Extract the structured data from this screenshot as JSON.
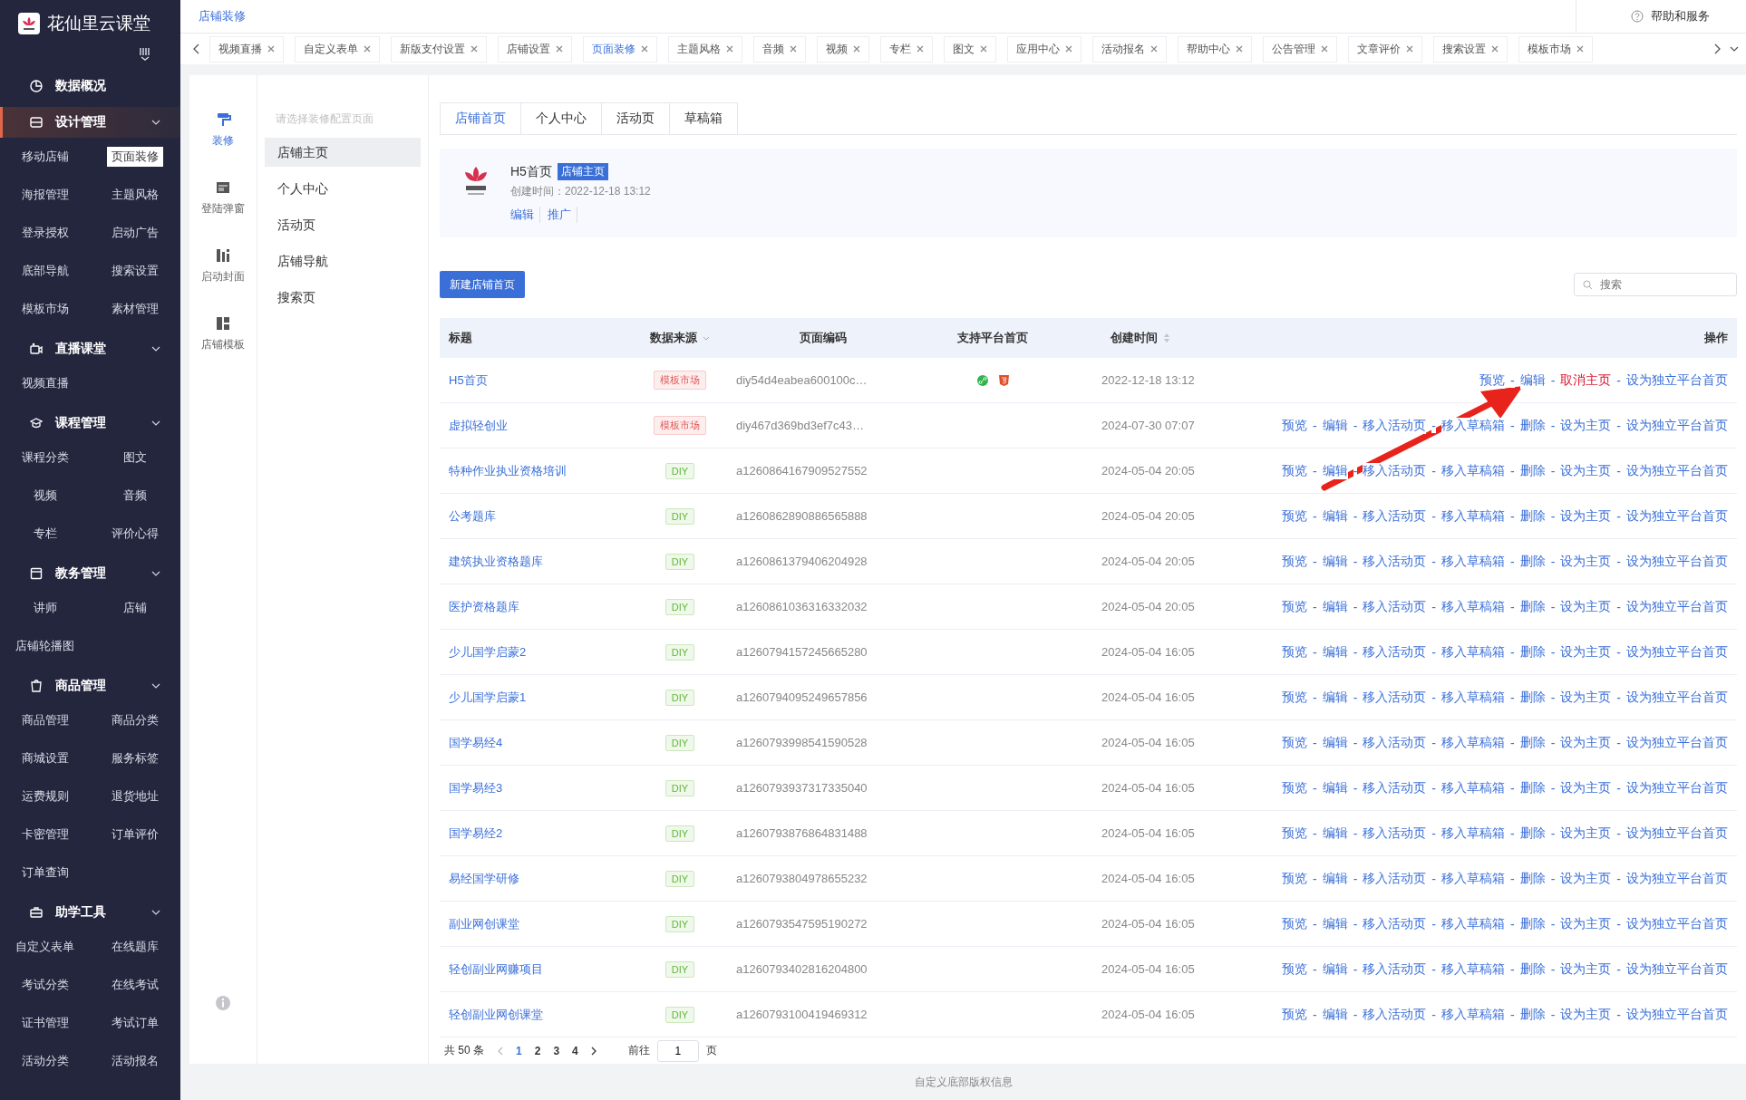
{
  "brand": {
    "name": "花仙里云课堂"
  },
  "sidebar": {
    "sections": [
      {
        "title": "数据概况",
        "kind": "link",
        "active": false
      },
      {
        "title": "设计管理",
        "kind": "group",
        "active": true,
        "items": [
          {
            "label": "移动店铺",
            "selected": false
          },
          {
            "label": "页面装修",
            "selected": true
          },
          {
            "label": "海报管理",
            "selected": false
          },
          {
            "label": "主题风格",
            "selected": false
          },
          {
            "label": "登录授权",
            "selected": false
          },
          {
            "label": "启动广告",
            "selected": false
          },
          {
            "label": "底部导航",
            "selected": false
          },
          {
            "label": "搜索设置",
            "selected": false
          },
          {
            "label": "模板市场",
            "selected": false
          },
          {
            "label": "素材管理",
            "selected": false
          }
        ]
      },
      {
        "title": "直播课堂",
        "kind": "group",
        "active": false,
        "items": [
          {
            "label": "视频直播",
            "selected": false
          }
        ]
      },
      {
        "title": "课程管理",
        "kind": "group",
        "active": false,
        "items": [
          {
            "label": "课程分类",
            "selected": false
          },
          {
            "label": "图文",
            "selected": false
          },
          {
            "label": "视频",
            "selected": false
          },
          {
            "label": "音频",
            "selected": false
          },
          {
            "label": "专栏",
            "selected": false
          },
          {
            "label": "评价心得",
            "selected": false
          }
        ]
      },
      {
        "title": "教务管理",
        "kind": "group",
        "active": false,
        "items": [
          {
            "label": "讲师",
            "selected": false
          },
          {
            "label": "店铺",
            "selected": false
          },
          {
            "label": "店铺轮播图",
            "selected": false
          }
        ]
      },
      {
        "title": "商品管理",
        "kind": "group",
        "active": false,
        "items": [
          {
            "label": "商品管理",
            "selected": false
          },
          {
            "label": "商品分类",
            "selected": false
          },
          {
            "label": "商城设置",
            "selected": false
          },
          {
            "label": "服务标签",
            "selected": false
          },
          {
            "label": "运费规则",
            "selected": false
          },
          {
            "label": "退货地址",
            "selected": false
          },
          {
            "label": "卡密管理",
            "selected": false
          },
          {
            "label": "订单评价",
            "selected": false
          },
          {
            "label": "订单查询",
            "selected": false
          }
        ]
      },
      {
        "title": "助学工具",
        "kind": "group",
        "active": false,
        "items": [
          {
            "label": "自定义表单",
            "selected": false
          },
          {
            "label": "在线题库",
            "selected": false
          },
          {
            "label": "考试分类",
            "selected": false
          },
          {
            "label": "在线考试",
            "selected": false
          },
          {
            "label": "证书管理",
            "selected": false
          },
          {
            "label": "考试订单",
            "selected": false
          },
          {
            "label": "活动分类",
            "selected": false
          },
          {
            "label": "活动报名",
            "selected": false
          }
        ]
      }
    ]
  },
  "breadcrumb": "店铺装修",
  "help": "帮助和服务",
  "tabs": [
    {
      "label": "视频直播",
      "selected": false
    },
    {
      "label": "自定义表单",
      "selected": false
    },
    {
      "label": "新版支付设置",
      "selected": false
    },
    {
      "label": "店铺设置",
      "selected": false
    },
    {
      "label": "页面装修",
      "selected": true
    },
    {
      "label": "主题风格",
      "selected": false
    },
    {
      "label": "音频",
      "selected": false
    },
    {
      "label": "视频",
      "selected": false
    },
    {
      "label": "专栏",
      "selected": false
    },
    {
      "label": "图文",
      "selected": false
    },
    {
      "label": "应用中心",
      "selected": false
    },
    {
      "label": "活动报名",
      "selected": false
    },
    {
      "label": "帮助中心",
      "selected": false
    },
    {
      "label": "公告管理",
      "selected": false
    },
    {
      "label": "文章评价",
      "selected": false
    },
    {
      "label": "搜索设置",
      "selected": false
    },
    {
      "label": "模板市场",
      "selected": false
    }
  ],
  "tool_rail": [
    {
      "label": "装修",
      "selected": true
    },
    {
      "label": "登陆弹窗",
      "selected": false
    },
    {
      "label": "启动封面",
      "selected": false
    },
    {
      "label": "店铺模板",
      "selected": false
    }
  ],
  "page_menu": {
    "placeholder": "请选择装修配置页面",
    "items": [
      {
        "label": "店铺主页",
        "selected": true
      },
      {
        "label": "个人中心",
        "selected": false
      },
      {
        "label": "活动页",
        "selected": false
      },
      {
        "label": "店铺导航",
        "selected": false
      },
      {
        "label": "搜索页",
        "selected": false
      }
    ]
  },
  "page_tabs": [
    {
      "label": "店铺首页",
      "selected": true
    },
    {
      "label": "个人中心",
      "selected": false
    },
    {
      "label": "活动页",
      "selected": false
    },
    {
      "label": "草稿箱",
      "selected": false
    }
  ],
  "home_card": {
    "title": "H5首页",
    "badge": "店铺主页",
    "created": "创建时间：2022-12-18 13:12",
    "links": [
      "编辑",
      "推广"
    ]
  },
  "new_button": "新建店铺首页",
  "search": {
    "placeholder": "搜索"
  },
  "table": {
    "columns": [
      {
        "label": "标题",
        "kind": "plain"
      },
      {
        "label": "数据来源",
        "kind": "filter"
      },
      {
        "label": "页面编码",
        "kind": "plain"
      },
      {
        "label": "支持平台首页",
        "kind": "plain"
      },
      {
        "label": "创建时间",
        "kind": "sort"
      },
      {
        "label": "操作",
        "kind": "plain"
      }
    ],
    "rows": [
      {
        "title": "H5首页",
        "source": {
          "label": "模板市场",
          "kind": "market"
        },
        "code": "diy54d4eabea600100c…",
        "platform_home": true,
        "created": "2022-12-18 13:12",
        "actions": [
          {
            "label": "预览",
            "kind": "link"
          },
          {
            "label": "-",
            "kind": "sep"
          },
          {
            "label": "编辑",
            "kind": "link"
          },
          {
            "label": "-",
            "kind": "sep"
          },
          {
            "label": "取消主页",
            "kind": "danger"
          },
          {
            "label": "-",
            "kind": "sep"
          },
          {
            "label": "设为独立平台首页",
            "kind": "link"
          }
        ]
      },
      {
        "title": "虚拟轻创业",
        "source": {
          "label": "模板市场",
          "kind": "market"
        },
        "code": "diy467d369bd3ef7c43…",
        "created": "2024-07-30 07:07",
        "actions": [
          {
            "label": "预览",
            "kind": "link"
          },
          {
            "label": "-",
            "kind": "sep"
          },
          {
            "label": "编辑",
            "kind": "link"
          },
          {
            "label": "-",
            "kind": "sep"
          },
          {
            "label": "移入活动页",
            "kind": "link"
          },
          {
            "label": "-",
            "kind": "sep"
          },
          {
            "label": "移入草稿箱",
            "kind": "link"
          },
          {
            "label": "-",
            "kind": "sep"
          },
          {
            "label": "删除",
            "kind": "link"
          },
          {
            "label": "-",
            "kind": "sep"
          },
          {
            "label": "设为主页",
            "kind": "link"
          },
          {
            "label": "-",
            "kind": "sep"
          },
          {
            "label": "设为独立平台首页",
            "kind": "link"
          }
        ]
      },
      {
        "title": "特种作业执业资格培训",
        "source": {
          "label": "DIY",
          "kind": "diy"
        },
        "code": "a1260864167909527552",
        "created": "2024-05-04 20:05",
        "actions": [
          {
            "label": "预览",
            "kind": "link"
          },
          {
            "label": "-",
            "kind": "sep"
          },
          {
            "label": "编辑",
            "kind": "link"
          },
          {
            "label": "-",
            "kind": "sep"
          },
          {
            "label": "移入活动页",
            "kind": "link"
          },
          {
            "label": "-",
            "kind": "sep"
          },
          {
            "label": "移入草稿箱",
            "kind": "link"
          },
          {
            "label": "-",
            "kind": "sep"
          },
          {
            "label": "删除",
            "kind": "link"
          },
          {
            "label": "-",
            "kind": "sep"
          },
          {
            "label": "设为主页",
            "kind": "link"
          },
          {
            "label": "-",
            "kind": "sep"
          },
          {
            "label": "设为独立平台首页",
            "kind": "link"
          }
        ]
      },
      {
        "title": "公考题库",
        "source": {
          "label": "DIY",
          "kind": "diy"
        },
        "code": "a1260862890886565888",
        "created": "2024-05-04 20:05",
        "actions": [
          {
            "label": "预览",
            "kind": "link"
          },
          {
            "label": "-",
            "kind": "sep"
          },
          {
            "label": "编辑",
            "kind": "link"
          },
          {
            "label": "-",
            "kind": "sep"
          },
          {
            "label": "移入活动页",
            "kind": "link"
          },
          {
            "label": "-",
            "kind": "sep"
          },
          {
            "label": "移入草稿箱",
            "kind": "link"
          },
          {
            "label": "-",
            "kind": "sep"
          },
          {
            "label": "删除",
            "kind": "link"
          },
          {
            "label": "-",
            "kind": "sep"
          },
          {
            "label": "设为主页",
            "kind": "link"
          },
          {
            "label": "-",
            "kind": "sep"
          },
          {
            "label": "设为独立平台首页",
            "kind": "link"
          }
        ]
      },
      {
        "title": "建筑执业资格题库",
        "source": {
          "label": "DIY",
          "kind": "diy"
        },
        "code": "a1260861379406204928",
        "created": "2024-05-04 20:05",
        "actions": [
          {
            "label": "预览",
            "kind": "link"
          },
          {
            "label": "-",
            "kind": "sep"
          },
          {
            "label": "编辑",
            "kind": "link"
          },
          {
            "label": "-",
            "kind": "sep"
          },
          {
            "label": "移入活动页",
            "kind": "link"
          },
          {
            "label": "-",
            "kind": "sep"
          },
          {
            "label": "移入草稿箱",
            "kind": "link"
          },
          {
            "label": "-",
            "kind": "sep"
          },
          {
            "label": "删除",
            "kind": "link"
          },
          {
            "label": "-",
            "kind": "sep"
          },
          {
            "label": "设为主页",
            "kind": "link"
          },
          {
            "label": "-",
            "kind": "sep"
          },
          {
            "label": "设为独立平台首页",
            "kind": "link"
          }
        ]
      },
      {
        "title": "医护资格题库",
        "source": {
          "label": "DIY",
          "kind": "diy"
        },
        "code": "a1260861036316332032",
        "created": "2024-05-04 20:05",
        "actions": [
          {
            "label": "预览",
            "kind": "link"
          },
          {
            "label": "-",
            "kind": "sep"
          },
          {
            "label": "编辑",
            "kind": "link"
          },
          {
            "label": "-",
            "kind": "sep"
          },
          {
            "label": "移入活动页",
            "kind": "link"
          },
          {
            "label": "-",
            "kind": "sep"
          },
          {
            "label": "移入草稿箱",
            "kind": "link"
          },
          {
            "label": "-",
            "kind": "sep"
          },
          {
            "label": "删除",
            "kind": "link"
          },
          {
            "label": "-",
            "kind": "sep"
          },
          {
            "label": "设为主页",
            "kind": "link"
          },
          {
            "label": "-",
            "kind": "sep"
          },
          {
            "label": "设为独立平台首页",
            "kind": "link"
          }
        ]
      },
      {
        "title": "少儿国学启蒙2",
        "source": {
          "label": "DIY",
          "kind": "diy"
        },
        "code": "a1260794157245665280",
        "created": "2024-05-04 16:05",
        "actions": [
          {
            "label": "预览",
            "kind": "link"
          },
          {
            "label": "-",
            "kind": "sep"
          },
          {
            "label": "编辑",
            "kind": "link"
          },
          {
            "label": "-",
            "kind": "sep"
          },
          {
            "label": "移入活动页",
            "kind": "link"
          },
          {
            "label": "-",
            "kind": "sep"
          },
          {
            "label": "移入草稿箱",
            "kind": "link"
          },
          {
            "label": "-",
            "kind": "sep"
          },
          {
            "label": "删除",
            "kind": "link"
          },
          {
            "label": "-",
            "kind": "sep"
          },
          {
            "label": "设为主页",
            "kind": "link"
          },
          {
            "label": "-",
            "kind": "sep"
          },
          {
            "label": "设为独立平台首页",
            "kind": "link"
          }
        ]
      },
      {
        "title": "少儿国学启蒙1",
        "source": {
          "label": "DIY",
          "kind": "diy"
        },
        "code": "a1260794095249657856",
        "created": "2024-05-04 16:05",
        "actions": [
          {
            "label": "预览",
            "kind": "link"
          },
          {
            "label": "-",
            "kind": "sep"
          },
          {
            "label": "编辑",
            "kind": "link"
          },
          {
            "label": "-",
            "kind": "sep"
          },
          {
            "label": "移入活动页",
            "kind": "link"
          },
          {
            "label": "-",
            "kind": "sep"
          },
          {
            "label": "移入草稿箱",
            "kind": "link"
          },
          {
            "label": "-",
            "kind": "sep"
          },
          {
            "label": "删除",
            "kind": "link"
          },
          {
            "label": "-",
            "kind": "sep"
          },
          {
            "label": "设为主页",
            "kind": "link"
          },
          {
            "label": "-",
            "kind": "sep"
          },
          {
            "label": "设为独立平台首页",
            "kind": "link"
          }
        ]
      },
      {
        "title": "国学易经4",
        "source": {
          "label": "DIY",
          "kind": "diy"
        },
        "code": "a1260793998541590528",
        "created": "2024-05-04 16:05",
        "actions": [
          {
            "label": "预览",
            "kind": "link"
          },
          {
            "label": "-",
            "kind": "sep"
          },
          {
            "label": "编辑",
            "kind": "link"
          },
          {
            "label": "-",
            "kind": "sep"
          },
          {
            "label": "移入活动页",
            "kind": "link"
          },
          {
            "label": "-",
            "kind": "sep"
          },
          {
            "label": "移入草稿箱",
            "kind": "link"
          },
          {
            "label": "-",
            "kind": "sep"
          },
          {
            "label": "删除",
            "kind": "link"
          },
          {
            "label": "-",
            "kind": "sep"
          },
          {
            "label": "设为主页",
            "kind": "link"
          },
          {
            "label": "-",
            "kind": "sep"
          },
          {
            "label": "设为独立平台首页",
            "kind": "link"
          }
        ]
      },
      {
        "title": "国学易经3",
        "source": {
          "label": "DIY",
          "kind": "diy"
        },
        "code": "a1260793937317335040",
        "created": "2024-05-04 16:05",
        "actions": [
          {
            "label": "预览",
            "kind": "link"
          },
          {
            "label": "-",
            "kind": "sep"
          },
          {
            "label": "编辑",
            "kind": "link"
          },
          {
            "label": "-",
            "kind": "sep"
          },
          {
            "label": "移入活动页",
            "kind": "link"
          },
          {
            "label": "-",
            "kind": "sep"
          },
          {
            "label": "移入草稿箱",
            "kind": "link"
          },
          {
            "label": "-",
            "kind": "sep"
          },
          {
            "label": "删除",
            "kind": "link"
          },
          {
            "label": "-",
            "kind": "sep"
          },
          {
            "label": "设为主页",
            "kind": "link"
          },
          {
            "label": "-",
            "kind": "sep"
          },
          {
            "label": "设为独立平台首页",
            "kind": "link"
          }
        ]
      },
      {
        "title": "国学易经2",
        "source": {
          "label": "DIY",
          "kind": "diy"
        },
        "code": "a1260793876864831488",
        "created": "2024-05-04 16:05",
        "actions": [
          {
            "label": "预览",
            "kind": "link"
          },
          {
            "label": "-",
            "kind": "sep"
          },
          {
            "label": "编辑",
            "kind": "link"
          },
          {
            "label": "-",
            "kind": "sep"
          },
          {
            "label": "移入活动页",
            "kind": "link"
          },
          {
            "label": "-",
            "kind": "sep"
          },
          {
            "label": "移入草稿箱",
            "kind": "link"
          },
          {
            "label": "-",
            "kind": "sep"
          },
          {
            "label": "删除",
            "kind": "link"
          },
          {
            "label": "-",
            "kind": "sep"
          },
          {
            "label": "设为主页",
            "kind": "link"
          },
          {
            "label": "-",
            "kind": "sep"
          },
          {
            "label": "设为独立平台首页",
            "kind": "link"
          }
        ]
      },
      {
        "title": "易经国学研修",
        "source": {
          "label": "DIY",
          "kind": "diy"
        },
        "code": "a1260793804978655232",
        "created": "2024-05-04 16:05",
        "actions": [
          {
            "label": "预览",
            "kind": "link"
          },
          {
            "label": "-",
            "kind": "sep"
          },
          {
            "label": "编辑",
            "kind": "link"
          },
          {
            "label": "-",
            "kind": "sep"
          },
          {
            "label": "移入活动页",
            "kind": "link"
          },
          {
            "label": "-",
            "kind": "sep"
          },
          {
            "label": "移入草稿箱",
            "kind": "link"
          },
          {
            "label": "-",
            "kind": "sep"
          },
          {
            "label": "删除",
            "kind": "link"
          },
          {
            "label": "-",
            "kind": "sep"
          },
          {
            "label": "设为主页",
            "kind": "link"
          },
          {
            "label": "-",
            "kind": "sep"
          },
          {
            "label": "设为独立平台首页",
            "kind": "link"
          }
        ]
      },
      {
        "title": "副业网创课堂",
        "source": {
          "label": "DIY",
          "kind": "diy"
        },
        "code": "a1260793547595190272",
        "created": "2024-05-04 16:05",
        "actions": [
          {
            "label": "预览",
            "kind": "link"
          },
          {
            "label": "-",
            "kind": "sep"
          },
          {
            "label": "编辑",
            "kind": "link"
          },
          {
            "label": "-",
            "kind": "sep"
          },
          {
            "label": "移入活动页",
            "kind": "link"
          },
          {
            "label": "-",
            "kind": "sep"
          },
          {
            "label": "移入草稿箱",
            "kind": "link"
          },
          {
            "label": "-",
            "kind": "sep"
          },
          {
            "label": "删除",
            "kind": "link"
          },
          {
            "label": "-",
            "kind": "sep"
          },
          {
            "label": "设为主页",
            "kind": "link"
          },
          {
            "label": "-",
            "kind": "sep"
          },
          {
            "label": "设为独立平台首页",
            "kind": "link"
          }
        ]
      },
      {
        "title": "轻创副业网赚项目",
        "source": {
          "label": "DIY",
          "kind": "diy"
        },
        "code": "a1260793402816204800",
        "created": "2024-05-04 16:05",
        "actions": [
          {
            "label": "预览",
            "kind": "link"
          },
          {
            "label": "-",
            "kind": "sep"
          },
          {
            "label": "编辑",
            "kind": "link"
          },
          {
            "label": "-",
            "kind": "sep"
          },
          {
            "label": "移入活动页",
            "kind": "link"
          },
          {
            "label": "-",
            "kind": "sep"
          },
          {
            "label": "移入草稿箱",
            "kind": "link"
          },
          {
            "label": "-",
            "kind": "sep"
          },
          {
            "label": "删除",
            "kind": "link"
          },
          {
            "label": "-",
            "kind": "sep"
          },
          {
            "label": "设为主页",
            "kind": "link"
          },
          {
            "label": "-",
            "kind": "sep"
          },
          {
            "label": "设为独立平台首页",
            "kind": "link"
          }
        ]
      },
      {
        "title": "轻创副业网创课堂",
        "source": {
          "label": "DIY",
          "kind": "diy"
        },
        "code": "a1260793100419469312",
        "created": "2024-05-04 16:05",
        "actions": [
          {
            "label": "预览",
            "kind": "link"
          },
          {
            "label": "-",
            "kind": "sep"
          },
          {
            "label": "编辑",
            "kind": "link"
          },
          {
            "label": "-",
            "kind": "sep"
          },
          {
            "label": "移入活动页",
            "kind": "link"
          },
          {
            "label": "-",
            "kind": "sep"
          },
          {
            "label": "移入草稿箱",
            "kind": "link"
          },
          {
            "label": "-",
            "kind": "sep"
          },
          {
            "label": "删除",
            "kind": "link"
          },
          {
            "label": "-",
            "kind": "sep"
          },
          {
            "label": "设为主页",
            "kind": "link"
          },
          {
            "label": "-",
            "kind": "sep"
          },
          {
            "label": "设为独立平台首页",
            "kind": "link"
          }
        ]
      }
    ]
  },
  "pagination": {
    "total": "共 50 条",
    "pages": [
      {
        "label": "1",
        "selected": true
      },
      {
        "label": "2",
        "selected": false
      },
      {
        "label": "3",
        "selected": false
      },
      {
        "label": "4",
        "selected": false
      }
    ],
    "goto_label": "前往",
    "goto_value": "1",
    "goto_suffix": "页"
  },
  "footer": "自定义底部版权信息"
}
